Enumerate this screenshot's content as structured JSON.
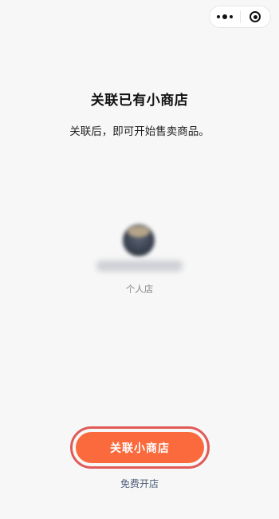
{
  "header": {
    "capsule": {
      "more_icon": "ellipsis-dots-icon",
      "close_icon": "target-circle-icon"
    }
  },
  "main": {
    "title": "关联已有小商店",
    "subtitle": "关联后，即可开始售卖商品。",
    "shop": {
      "type_label": "个人店"
    }
  },
  "actions": {
    "primary_label": "关联小商店",
    "secondary_label": "免费开店"
  },
  "colors": {
    "background": "#f7f7f7",
    "primary": "#fa6a3c",
    "highlight_outline": "#e05a57",
    "link": "#4a5b77",
    "muted_text": "#8a8a8a"
  }
}
